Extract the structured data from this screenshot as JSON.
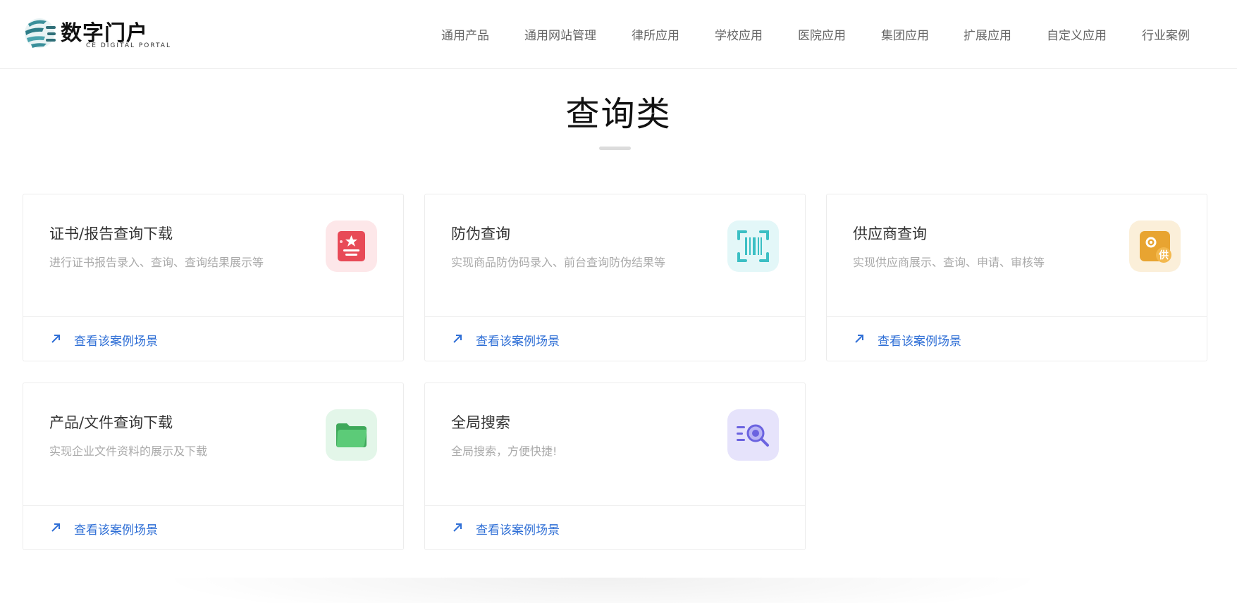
{
  "brand": {
    "title": "数字门户",
    "subtitle": "CE DIGITAL PORTAL",
    "logo_icon": "globe-logo-icon"
  },
  "nav": {
    "items": [
      {
        "label": "通用产品"
      },
      {
        "label": "通用网站管理"
      },
      {
        "label": "律所应用"
      },
      {
        "label": "学校应用"
      },
      {
        "label": "医院应用"
      },
      {
        "label": "集团应用"
      },
      {
        "label": "扩展应用"
      },
      {
        "label": "自定义应用"
      },
      {
        "label": "行业案例"
      }
    ]
  },
  "section": {
    "title": "查询类"
  },
  "cards": [
    {
      "title": "证书/报告查询下载",
      "desc": "进行证书报告录入、查询、查询结果展示等",
      "link": "查看该案例场景",
      "icon": "certificate-icon",
      "icon_bg": "#fde7e9",
      "icon_color": "#e84a57"
    },
    {
      "title": "防伪查询",
      "desc": "实现商品防伪码录入、前台查询防伪结果等",
      "link": "查看该案例场景",
      "icon": "barcode-scan-icon",
      "icon_bg": "#e3f7f8",
      "icon_color": "#3bbfc4"
    },
    {
      "title": "供应商查询",
      "desc": "实现供应商展示、查询、申请、审核等",
      "link": "查看该案例场景",
      "icon": "supplier-icon",
      "icon_bg": "#fbefd9",
      "icon_color": "#e8a431",
      "icon_char": "供"
    },
    {
      "title": "产品/文件查询下载",
      "desc": "实现企业文件资料的展示及下载",
      "link": "查看该案例场景",
      "icon": "folder-icon",
      "icon_bg": "#e3f6e9",
      "icon_color": "#4cba68"
    },
    {
      "title": "全局搜索",
      "desc": "全局搜索，方便快捷!",
      "link": "查看该案例场景",
      "icon": "search-list-icon",
      "icon_bg": "#e6e3fb",
      "icon_color": "#6b63e0"
    }
  ],
  "colors": {
    "link": "#2f6fd6",
    "nav_text": "#666666"
  }
}
